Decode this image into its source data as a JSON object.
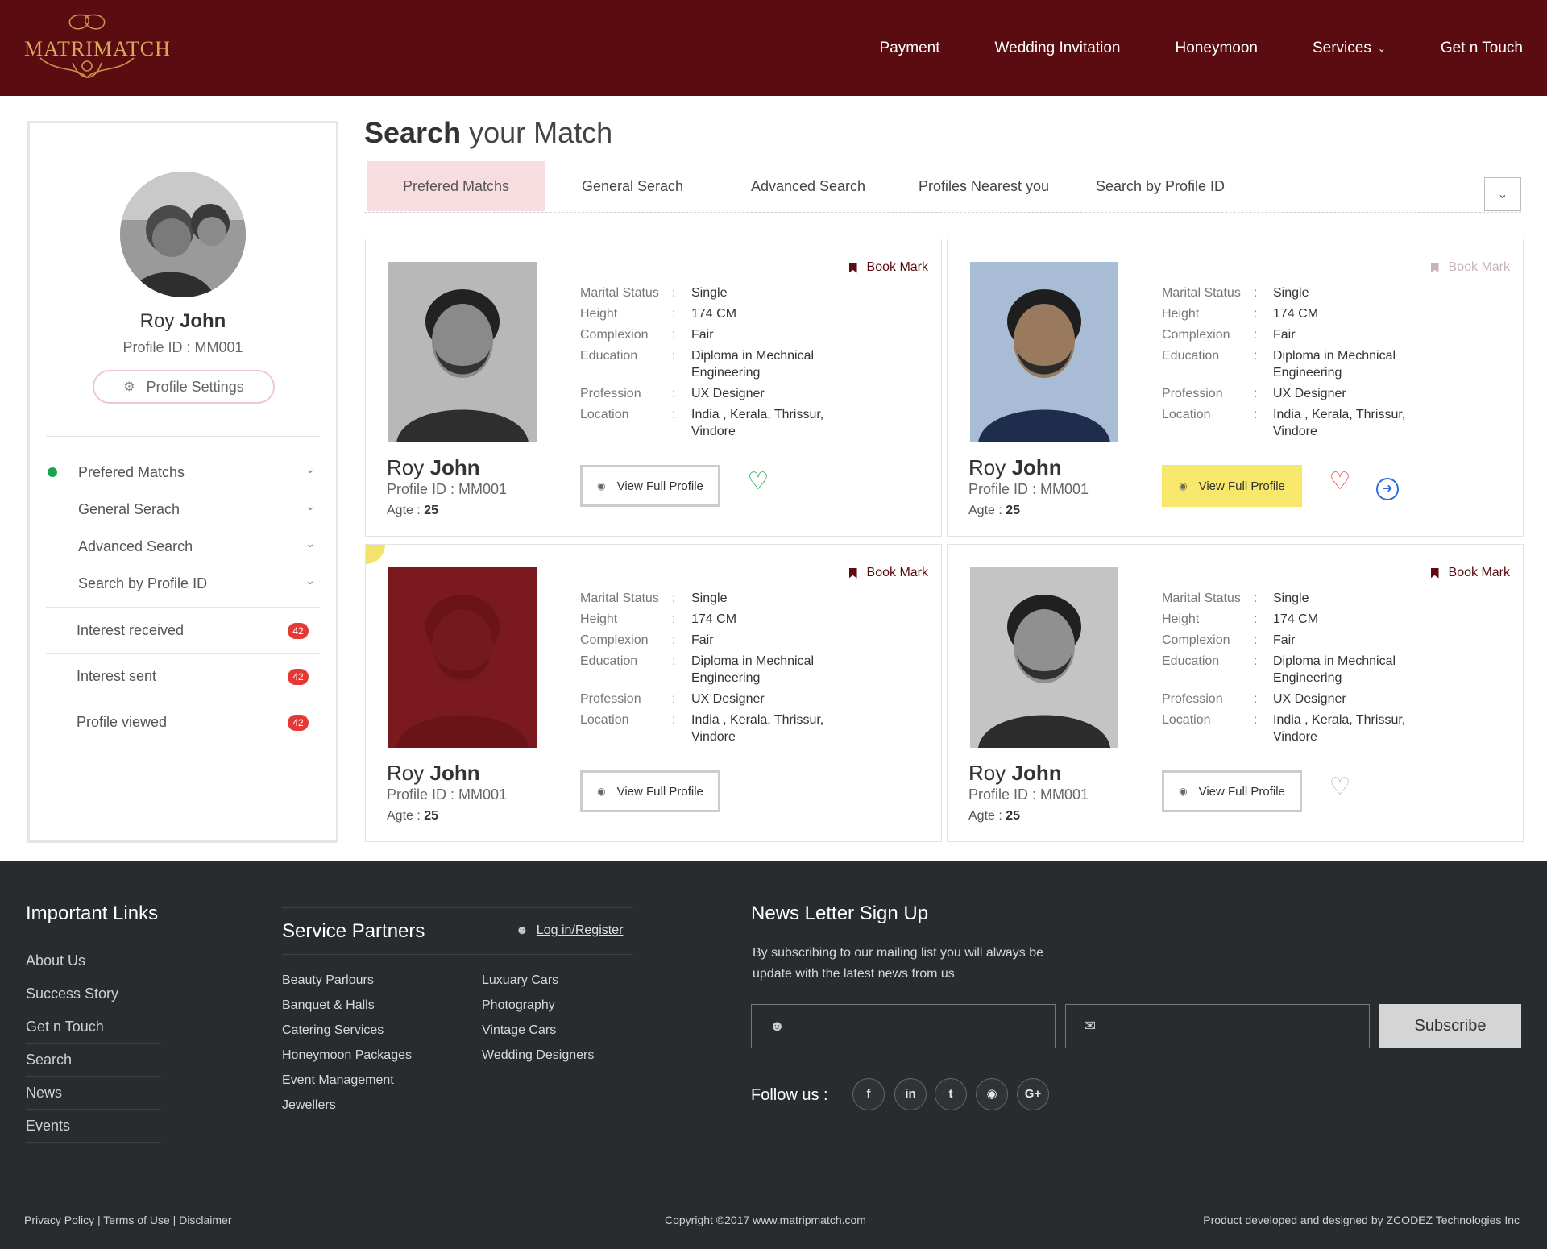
{
  "brand": {
    "logo_text": "MATRIMATCH"
  },
  "nav": {
    "items": [
      "Payment",
      "Wedding Invitation",
      "Honeymoon",
      "Services",
      "Get n Touch"
    ]
  },
  "sidebar": {
    "name_first": "Roy",
    "name_last": "John",
    "profile_id": "Profile ID : MM001",
    "settings_label": "Profile Settings",
    "menu": [
      {
        "label": "Prefered Matchs",
        "active": true
      },
      {
        "label": "General Serach"
      },
      {
        "label": "Advanced Search"
      },
      {
        "label": "Search by Profile ID"
      }
    ],
    "counts": [
      {
        "label": "Interest received",
        "count": "42"
      },
      {
        "label": "Interest sent",
        "count": "42"
      },
      {
        "label": "Profile viewed",
        "count": "42"
      }
    ]
  },
  "main": {
    "title_bold": "Search",
    "title_rest": "your Match",
    "tabs": [
      "Prefered Matchs",
      "General Serach",
      "Advanced Search",
      "Profiles Nearest you",
      "Search  by Profile ID"
    ],
    "field_labels": {
      "marital": "Marital Status",
      "height": "Height",
      "complexion": "Complexion",
      "education": "Education",
      "profession": "Profession",
      "location": "Location"
    },
    "colon": ":",
    "bookmark_label": "Book Mark",
    "view_label": "View Full Profile",
    "age_label": "Agte :",
    "cards": [
      {
        "first": "Roy",
        "last": "John",
        "pid": "Profile ID : MM001",
        "age": "25",
        "marital": "Single",
        "height": "174 CM",
        "complexion": "Fair",
        "education": "Diploma in Mechnical Engineering",
        "profession": "UX Designer",
        "location": "India , Kerala, Thrissur, Vindore"
      },
      {
        "first": "Roy",
        "last": "John",
        "pid": "Profile ID : MM001",
        "age": "25",
        "marital": "Single",
        "height": "174 CM",
        "complexion": "Fair",
        "education": "Diploma in Mechnical Engineering",
        "profession": "UX Designer",
        "location": "India , Kerala, Thrissur, Vindore"
      },
      {
        "first": "Roy",
        "last": "John",
        "pid": "Profile ID : MM001",
        "age": "25",
        "marital": "Single",
        "height": "174 CM",
        "complexion": "Fair",
        "education": "Diploma in Mechnical Engineering",
        "profession": "UX Designer",
        "location": "India , Kerala, Thrissur, Vindore"
      },
      {
        "first": "Roy",
        "last": "John",
        "pid": "Profile ID : MM001",
        "age": "25",
        "marital": "Single",
        "height": "174 CM",
        "complexion": "Fair",
        "education": "Diploma in Mechnical Engineering",
        "profession": "UX Designer",
        "location": "India , Kerala, Thrissur, Vindore"
      }
    ]
  },
  "footer": {
    "important_title": "Important Links",
    "important_links": [
      "About Us",
      "Success Story",
      "Get n Touch",
      "Search",
      "News",
      "Events"
    ],
    "partners_title": "Service Partners",
    "login_label": "Log in/Register",
    "partners_col1": [
      "Beauty Parlours",
      "Banquet & Halls",
      "Catering Services",
      "Honeymoon Packages",
      "Event Management",
      "Jewellers"
    ],
    "partners_col2": [
      "Luxuary Cars",
      "Photography",
      "Vintage Cars",
      "Wedding Designers"
    ],
    "newsletter_title": "News Letter Sign Up",
    "newsletter_text": "By subscribing to our mailing list you will always be update with the latest news from us",
    "subscribe_label": "Subscribe",
    "follow_label": "Follow us :",
    "social": [
      "facebook-icon",
      "linkedin-icon",
      "twitter-icon",
      "instagram-icon",
      "google-plus-icon"
    ],
    "policy_links": "Privacy Policy | Terms of Use | Disclaimer",
    "copyright": "Copyright ©2017 www.matripmatch.com",
    "credit": "Product developed and designed by ZCODEZ Technologies Inc"
  },
  "colors": {
    "brand": "#5a0c10",
    "accent_yellow": "#f7e86c",
    "badge": "#e53935",
    "online": "#1aa54a"
  }
}
